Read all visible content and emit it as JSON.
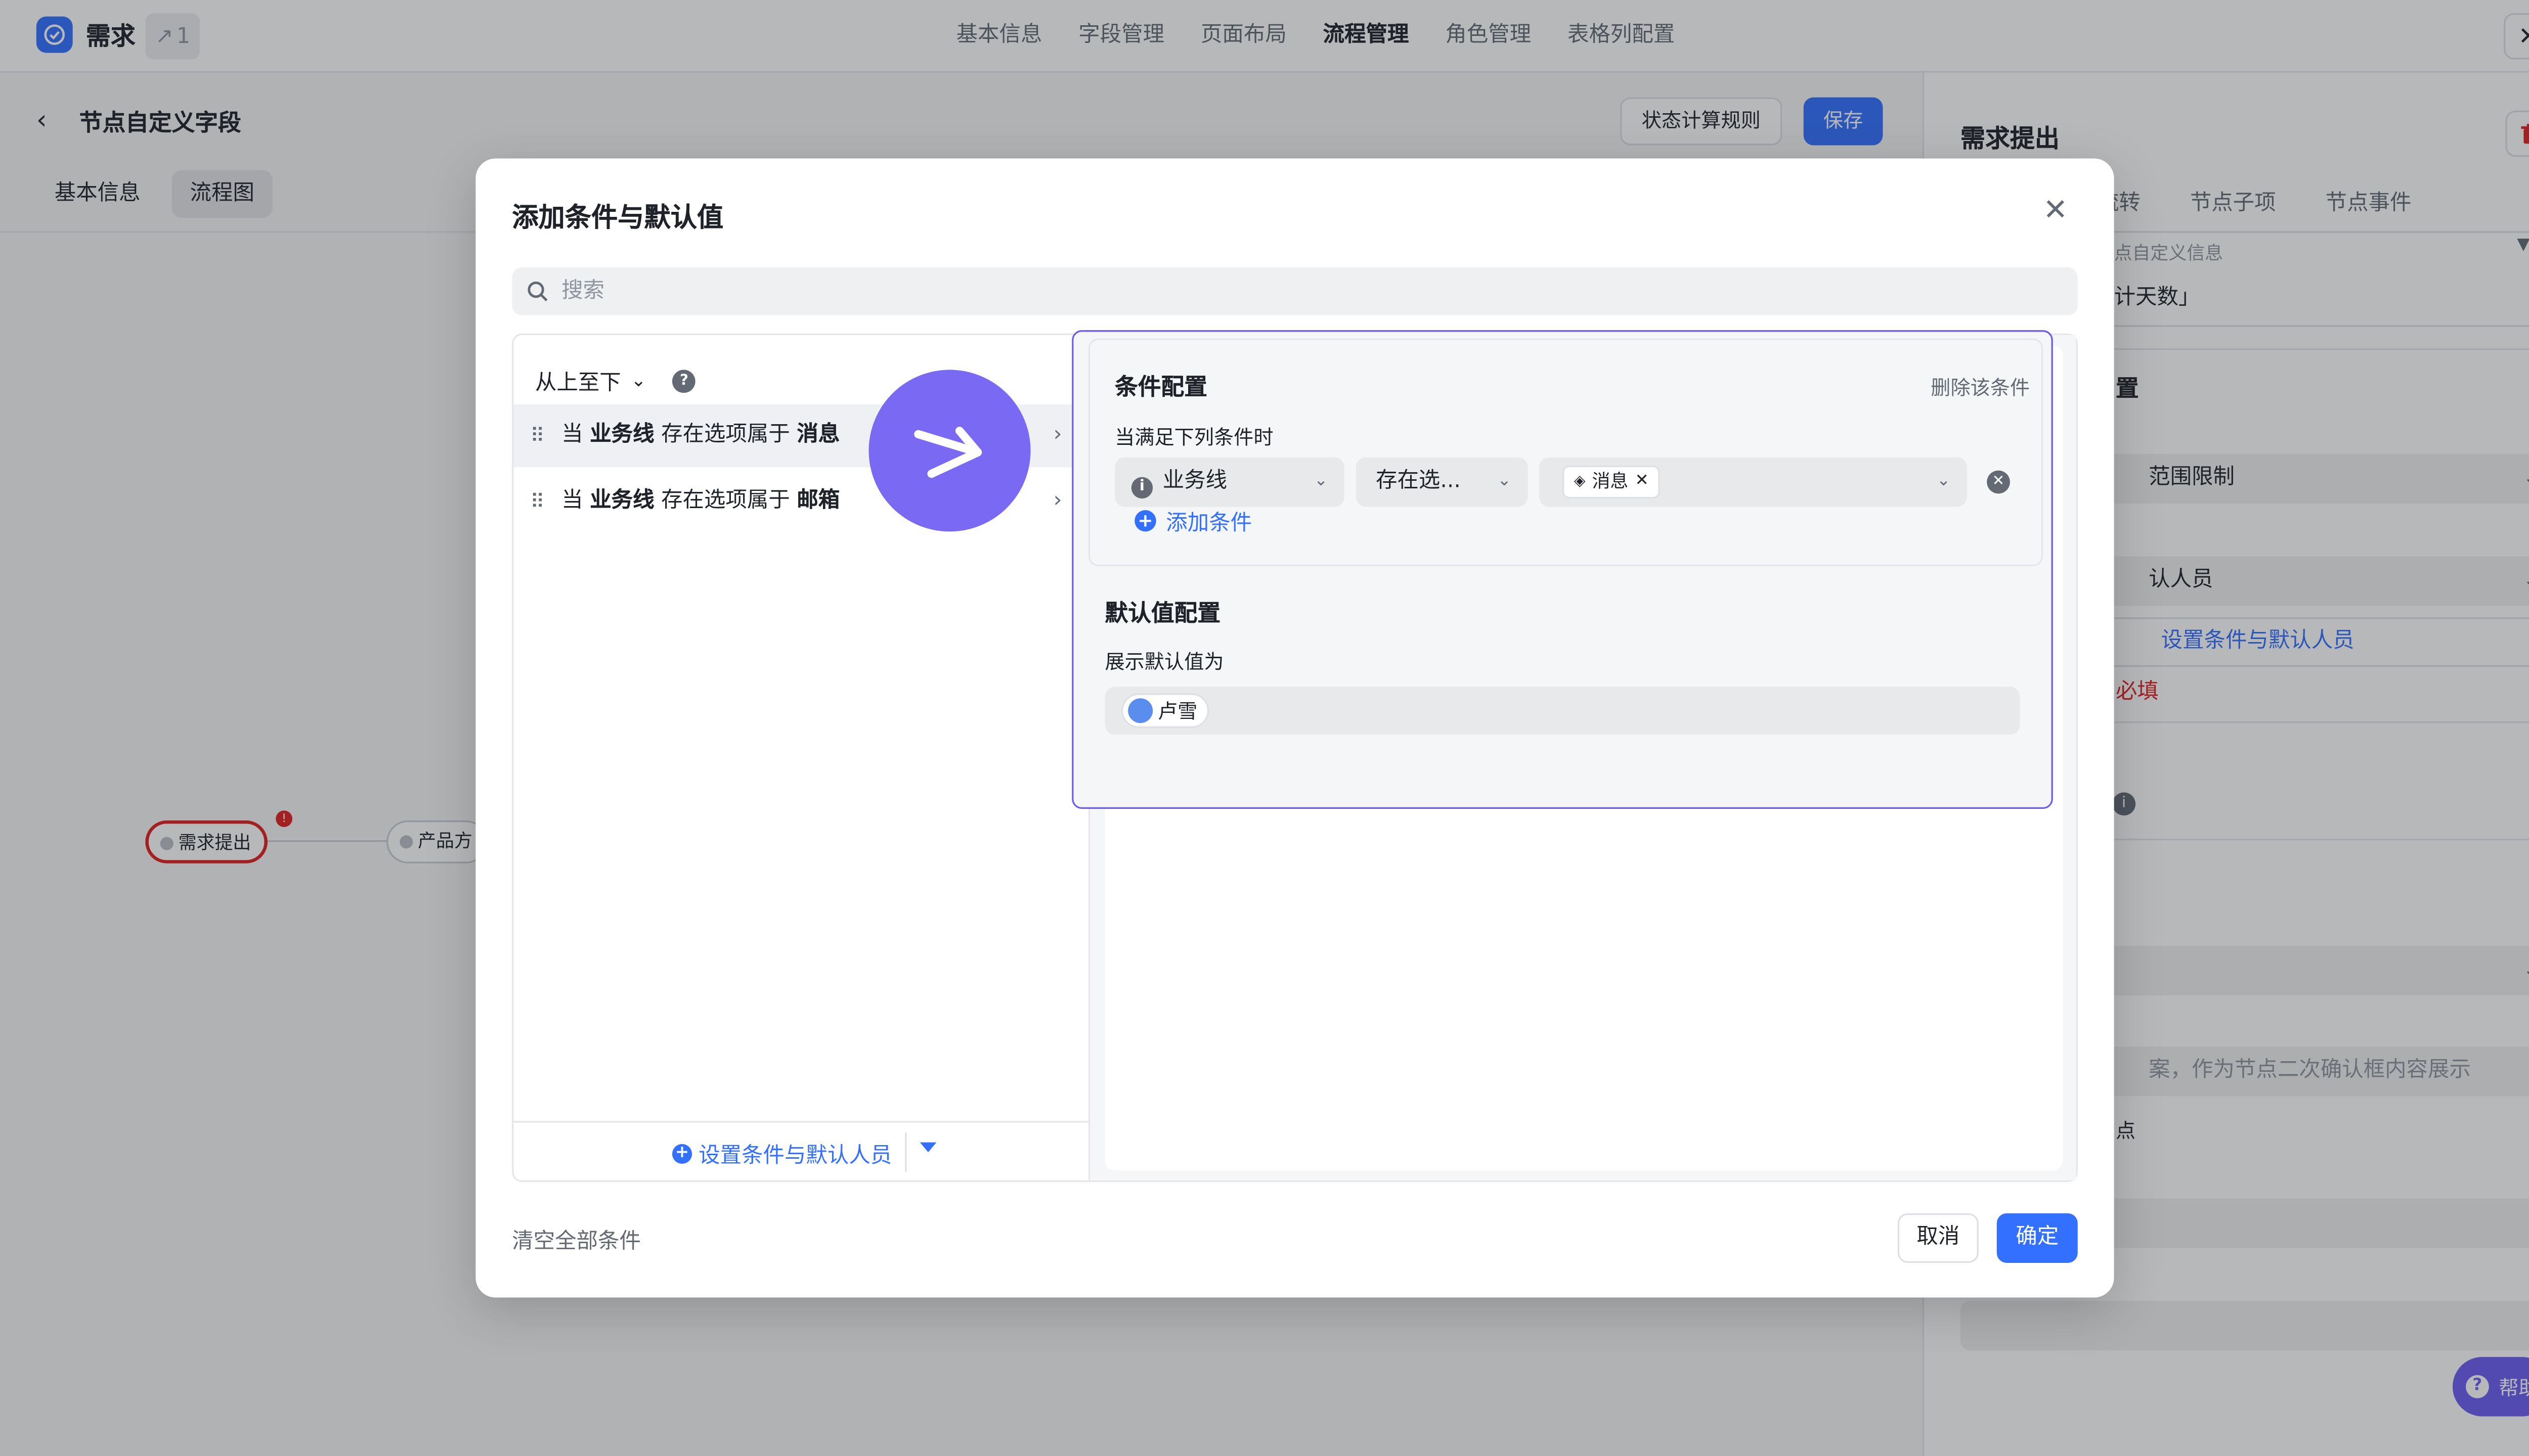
{
  "app": {
    "title": "需求",
    "version": "1"
  },
  "top_nav": [
    "基本信息",
    "字段管理",
    "页面布局",
    "流程管理",
    "角色管理",
    "表格列配置"
  ],
  "header": {
    "title": "节点自定义字段",
    "rule_btn": "状态计算规则",
    "save_btn": "保存"
  },
  "sub_tabs": [
    "基本信息",
    "流程图"
  ],
  "flow": {
    "node1": "需求提出",
    "node2": "产品方"
  },
  "right_panel": {
    "title": "需求提出",
    "tabs": [
      "点流转",
      "节点子项",
      "节点事件"
    ],
    "custom_label": "点自定义信息",
    "custom_value": "计天数」",
    "section_heading": "置",
    "range_select": "范围限制",
    "person_select": "认人员",
    "set_link": "设置条件与默认人员",
    "required_text": "必填",
    "placeholder_text": "案，作为节点二次确认框内容展示",
    "small_text": "点"
  },
  "help": "帮助",
  "dialog": {
    "title": "添加条件与默认值",
    "search_placeholder": "搜索",
    "sort_label": "从上至下",
    "conditions": [
      {
        "prefix": "当",
        "field": "业务线",
        "op": "存在选项属于",
        "value": "消息"
      },
      {
        "prefix": "当",
        "field": "业务线",
        "op": "存在选项属于",
        "value": "邮箱"
      }
    ],
    "add_btn": "设置条件与默认人员",
    "config": {
      "heading": "条件配置",
      "delete": "删除该条件",
      "when": "当满足下列条件时",
      "field": "业务线",
      "op": "存在选...",
      "tag": "消息",
      "add_filter": "添加条件"
    },
    "default": {
      "heading": "默认值配置",
      "label": "展示默认值为",
      "user": "卢雪"
    },
    "clear_all": "清空全部条件",
    "cancel": "取消",
    "confirm": "确定"
  }
}
